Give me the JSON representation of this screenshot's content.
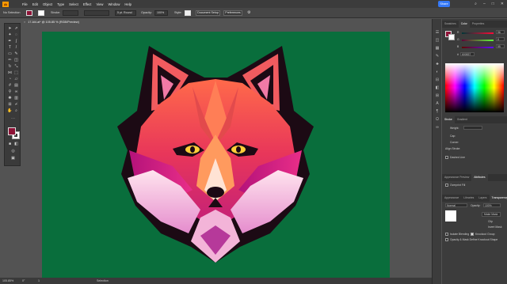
{
  "menubar": {
    "logo": "Ai",
    "items": [
      "File",
      "Edit",
      "Object",
      "Type",
      "Select",
      "Effect",
      "View",
      "Window",
      "Help"
    ],
    "share_label": "Share"
  },
  "controlbar": {
    "selection_label": "No Selection",
    "stroke_label": "Stroke:",
    "brush_label": "5 pt. Round",
    "opacity_label": "Opacity:",
    "opacity_value": "100%",
    "style_label": "Style:",
    "document_setup": "Document Setup",
    "preferences": "Preferences"
  },
  "document": {
    "tab_title": "17.Al4.ai* @ 105.85 % (RGB/Preview)"
  },
  "statusbar": {
    "zoom": "105.85%",
    "rotation": "0°",
    "artboard": "1",
    "tool": "Selection"
  },
  "panels": {
    "top_tabs": [
      "Swatches",
      "Color",
      "Properties"
    ],
    "color_channels": [
      {
        "label": "R",
        "value": "96"
      },
      {
        "label": "G",
        "value": "8"
      },
      {
        "label": "B",
        "value": "55"
      }
    ],
    "hex_value": "600837",
    "stroke_tabs": [
      "Stroke",
      "Gradient"
    ],
    "stroke_rows": [
      "Weight:",
      "Cap:",
      "Corner:",
      "Align Stroke:"
    ],
    "dashed_line": "Dashed Line",
    "transparency_tabs_1": [
      "Appearance Preview",
      "Attributes"
    ],
    "overprint_fill": "Overprint Fill",
    "transparency_tabs_2": [
      "Appearance",
      "Libraries",
      "Layers",
      "Transparency"
    ],
    "blend_mode": "Normal",
    "opacity_label": "Opacity:",
    "opacity_value": "100%",
    "make_mask": "Make Mask",
    "clip": "Clip",
    "invert_mask": "Invert Mask",
    "isolate_blending": "Isolate Blending",
    "knockout_group": "Knockout Group",
    "opacity_mask_define": "Opacity & Mask Define Knockout Shape"
  },
  "colors": {
    "canvas": "#096e3c",
    "fill": "#8e1337",
    "accent": "#3478f6"
  }
}
